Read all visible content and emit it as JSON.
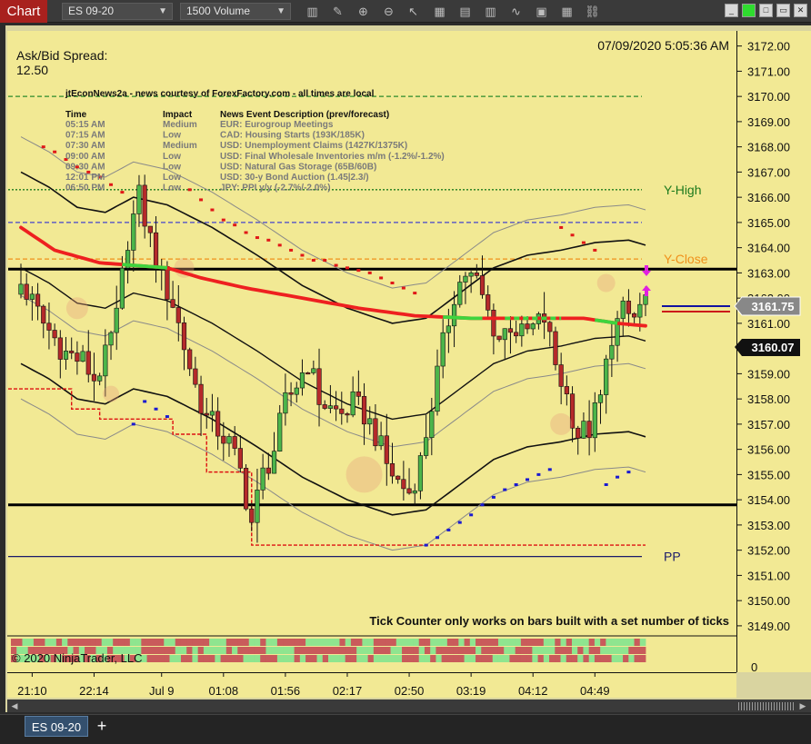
{
  "toolbar": {
    "chart_tab": "Chart",
    "instrument": "ES 09-20",
    "bar_type": "1500 Volume",
    "window_controls": [
      "minimize-icon",
      "restore-icon",
      "maximize-icon",
      "close-icon"
    ]
  },
  "header": {
    "ask_bid_label": "Ask/Bid Spread:",
    "ask_bid_value": "12.50",
    "datetime": "07/09/2020 5:05:36 AM"
  },
  "news": {
    "title": "jtEconNews2a - news courtesy of ForexFactory.com - all times are local",
    "columns": [
      "Time",
      "Impact",
      "News Event Description (prev/forecast)"
    ],
    "rows": [
      [
        "05:15 AM",
        "Medium",
        "EUR: Eurogroup Meetings"
      ],
      [
        "07:15 AM",
        "Low",
        "CAD: Housing Starts (193K/185K)"
      ],
      [
        "07:30 AM",
        "Medium",
        "USD: Unemployment Claims (1427K/1375K)"
      ],
      [
        "09:00 AM",
        "Low",
        "USD: Final Wholesale Inventories m/m (-1.2%/-1.2%)"
      ],
      [
        "09:30 AM",
        "Low",
        "USD: Natural Gas Storage (65B/60B)"
      ],
      [
        "12:01 PM",
        "Low",
        "USD: 30-y Bond Auction (1.45|2.3/)"
      ],
      [
        "06:50 PM",
        "Low",
        "JPY: PPI y/y (-2.7%/-2.0%)"
      ]
    ]
  },
  "footer": {
    "tick_counter": "Tick Counter only works on bars built with a set number of ticks",
    "copyright": "© 2020 NinjaTrader, LLC"
  },
  "bottom": {
    "instrument_tab": "ES 09-20",
    "add_tab": "+"
  },
  "colors": {
    "chart_bg": "#f2e994",
    "up_bar": "#4cb54a",
    "down_bar": "#b52a2a",
    "ma_red": "#ee2020",
    "ma_green": "#3ed43e",
    "y_high": "#1d7a1d",
    "y_close": "#f0901a",
    "pp": "#1a1a6a"
  },
  "chart_data": {
    "type": "candlestick",
    "instrument": "ES 09-20",
    "y_range": [
      3148.6,
      3172.6
    ],
    "y_ticks": [
      3149,
      3150,
      3151,
      3152,
      3153,
      3154,
      3155,
      3156,
      3157,
      3158,
      3159,
      3160,
      3161,
      3162,
      3163,
      3164,
      3165,
      3166,
      3167,
      3168,
      3169,
      3170,
      3171,
      3172
    ],
    "x_labels": [
      "21:10",
      "22:14",
      "Jul 9",
      "01:08",
      "01:56",
      "02:17",
      "02:50",
      "03:19",
      "04:12",
      "04:49"
    ],
    "x_label_bars": [
      2,
      13,
      25,
      36,
      47,
      58,
      69,
      80,
      91,
      102
    ],
    "bar_count": 112,
    "last_price": "3161.75",
    "current_price": "3160.07",
    "levels": [
      {
        "name": "Y-High",
        "value": 3166.3,
        "color": "#1d7a1d",
        "style": "dotted"
      },
      {
        "name": "Y-Close",
        "value": 3163.55,
        "color": "#f0901a",
        "style": "dashed"
      },
      {
        "name": "",
        "value": 3170.0,
        "color": "#2c8c2c",
        "style": "dashed"
      },
      {
        "name": "",
        "value": 3165.0,
        "color": "#4444cc",
        "style": "dashed"
      },
      {
        "name": "",
        "value": 3163.15,
        "color": "#000000",
        "style": "solid"
      },
      {
        "name": "",
        "value": 3153.8,
        "color": "#000000",
        "style": "solid"
      },
      {
        "name": "PP",
        "value": 3151.75,
        "color": "#1a1a6a",
        "style": "solid"
      }
    ],
    "anchors": [
      [
        0,
        3162.6
      ],
      [
        4,
        3161.0
      ],
      [
        8,
        3159.8
      ],
      [
        11,
        3159.5
      ],
      [
        13,
        3158.8
      ],
      [
        15,
        3159.6
      ],
      [
        17,
        3161.2
      ],
      [
        19,
        3164.4
      ],
      [
        21,
        3166.0
      ],
      [
        23,
        3164.3
      ],
      [
        25,
        3162.8
      ],
      [
        27,
        3161.8
      ],
      [
        29,
        3160.1
      ],
      [
        31,
        3158.5
      ],
      [
        33,
        3157.2
      ],
      [
        35,
        3156.8
      ],
      [
        37,
        3156.2
      ],
      [
        39,
        3155.1
      ],
      [
        41,
        3153.1
      ],
      [
        43,
        3155.0
      ],
      [
        45,
        3156.0
      ],
      [
        47,
        3157.8
      ],
      [
        49,
        3158.6
      ],
      [
        51,
        3159.5
      ],
      [
        53,
        3158.0
      ],
      [
        55,
        3157.6
      ],
      [
        57,
        3157.4
      ],
      [
        59,
        3157.8
      ],
      [
        61,
        3157.4
      ],
      [
        63,
        3156.6
      ],
      [
        65,
        3155.4
      ],
      [
        67,
        3154.7
      ],
      [
        69,
        3154.3
      ],
      [
        71,
        3155.5
      ],
      [
        73,
        3157.8
      ],
      [
        75,
        3160.1
      ],
      [
        77,
        3162.2
      ],
      [
        79,
        3163.0
      ],
      [
        81,
        3162.6
      ],
      [
        83,
        3161.4
      ],
      [
        85,
        3160.4
      ],
      [
        87,
        3161.0
      ],
      [
        89,
        3160.5
      ],
      [
        91,
        3160.8
      ],
      [
        93,
        3161.2
      ],
      [
        95,
        3159.4
      ],
      [
        97,
        3158.1
      ],
      [
        99,
        3156.6
      ],
      [
        101,
        3156.8
      ],
      [
        103,
        3158.0
      ],
      [
        105,
        3160.6
      ],
      [
        107,
        3161.4
      ],
      [
        109,
        3161.2
      ],
      [
        111,
        3162.0
      ]
    ],
    "sma_anchors": [
      [
        0,
        3164.8
      ],
      [
        6,
        3163.9
      ],
      [
        14,
        3163.4
      ],
      [
        20,
        3163.3
      ],
      [
        26,
        3163.2
      ],
      [
        32,
        3162.8
      ],
      [
        40,
        3162.4
      ],
      [
        50,
        3162.0
      ],
      [
        60,
        3161.6
      ],
      [
        70,
        3161.3
      ],
      [
        80,
        3161.2
      ],
      [
        90,
        3161.2
      ],
      [
        100,
        3161.2
      ],
      [
        106,
        3161.0
      ],
      [
        111,
        3160.9
      ]
    ],
    "sma_green_segments": [
      [
        18,
        26
      ],
      [
        75,
        82
      ],
      [
        86,
        96
      ],
      [
        102,
        106
      ]
    ],
    "band_mid_anchors": [
      [
        0,
        3163.2
      ],
      [
        5,
        3162.6
      ],
      [
        10,
        3161.8
      ],
      [
        15,
        3161.6
      ],
      [
        20,
        3162.2
      ],
      [
        26,
        3161.9
      ],
      [
        34,
        3161.0
      ],
      [
        42,
        3159.9
      ],
      [
        50,
        3158.7
      ],
      [
        58,
        3157.8
      ],
      [
        66,
        3157.2
      ],
      [
        72,
        3157.4
      ],
      [
        78,
        3158.4
      ],
      [
        84,
        3159.4
      ],
      [
        90,
        3159.9
      ],
      [
        96,
        3160.1
      ],
      [
        102,
        3160.4
      ],
      [
        108,
        3160.5
      ],
      [
        111,
        3160.3
      ]
    ],
    "band_width": 3.8,
    "band_outer_width": 5.2,
    "psar_bars": [
      [
        4,
        3168.0
      ],
      [
        6,
        3167.8
      ],
      [
        8,
        3167.5
      ],
      [
        10,
        3167.2
      ],
      [
        12,
        3167.0
      ],
      [
        14,
        3166.8
      ],
      [
        16,
        3166.5
      ],
      [
        18,
        3166.2
      ],
      [
        22,
        3157.9
      ],
      [
        24,
        3157.6
      ],
      [
        26,
        3157.3
      ],
      [
        20,
        3157.0
      ],
      [
        30,
        3166.3
      ],
      [
        32,
        3165.9
      ],
      [
        34,
        3165.5
      ],
      [
        36,
        3165.1
      ],
      [
        38,
        3164.9
      ],
      [
        40,
        3164.6
      ],
      [
        42,
        3164.4
      ],
      [
        44,
        3164.3
      ],
      [
        46,
        3164.1
      ],
      [
        48,
        3163.9
      ],
      [
        50,
        3163.7
      ],
      [
        52,
        3163.5
      ],
      [
        54,
        3163.5
      ],
      [
        56,
        3163.3
      ],
      [
        58,
        3163.2
      ],
      [
        60,
        3163.1
      ],
      [
        62,
        3163.0
      ],
      [
        64,
        3162.8
      ],
      [
        66,
        3162.6
      ],
      [
        68,
        3162.4
      ],
      [
        70,
        3162.2
      ],
      [
        72,
        3152.2
      ],
      [
        74,
        3152.5
      ],
      [
        76,
        3152.8
      ],
      [
        78,
        3153.1
      ],
      [
        80,
        3153.4
      ],
      [
        82,
        3153.8
      ],
      [
        84,
        3154.1
      ],
      [
        86,
        3154.4
      ],
      [
        88,
        3154.6
      ],
      [
        90,
        3154.8
      ],
      [
        92,
        3155.0
      ],
      [
        94,
        3155.2
      ],
      [
        96,
        3164.8
      ],
      [
        98,
        3164.5
      ],
      [
        100,
        3164.2
      ],
      [
        102,
        3163.9
      ],
      [
        104,
        3154.6
      ],
      [
        106,
        3154.9
      ],
      [
        108,
        3155.1
      ]
    ],
    "step_levels": [
      [
        0,
        3158.4
      ],
      [
        9,
        3157.6
      ],
      [
        14,
        3157.2
      ],
      [
        27,
        3156.6
      ],
      [
        33,
        3155.1
      ],
      [
        41,
        3152.2
      ],
      [
        111,
        3152.2
      ]
    ],
    "volume_strip": {
      "rows": 3,
      "pattern": [
        1,
        1,
        0,
        0,
        1,
        1,
        1,
        1,
        0,
        0,
        1,
        1,
        1,
        1,
        1,
        1,
        0,
        0,
        1,
        1,
        1,
        1,
        0,
        1,
        1,
        1,
        0,
        0,
        0,
        1,
        1,
        1,
        1,
        1,
        1,
        1,
        0,
        0,
        1,
        1,
        1,
        1,
        0,
        0,
        0,
        0,
        0,
        1,
        1,
        1,
        1,
        1,
        0,
        0,
        0,
        0,
        0,
        0,
        1,
        1,
        1,
        1,
        0,
        0,
        1,
        1,
        1,
        1,
        0,
        0,
        0,
        0,
        1,
        1,
        1,
        0,
        0,
        1,
        1,
        0,
        0,
        0,
        1,
        1,
        1,
        1,
        1,
        0,
        0,
        0,
        1,
        1,
        1,
        1,
        0,
        0,
        1,
        1,
        1,
        0,
        0,
        0,
        1,
        1,
        1,
        1,
        0,
        0,
        0,
        1,
        1,
        0
      ]
    }
  }
}
